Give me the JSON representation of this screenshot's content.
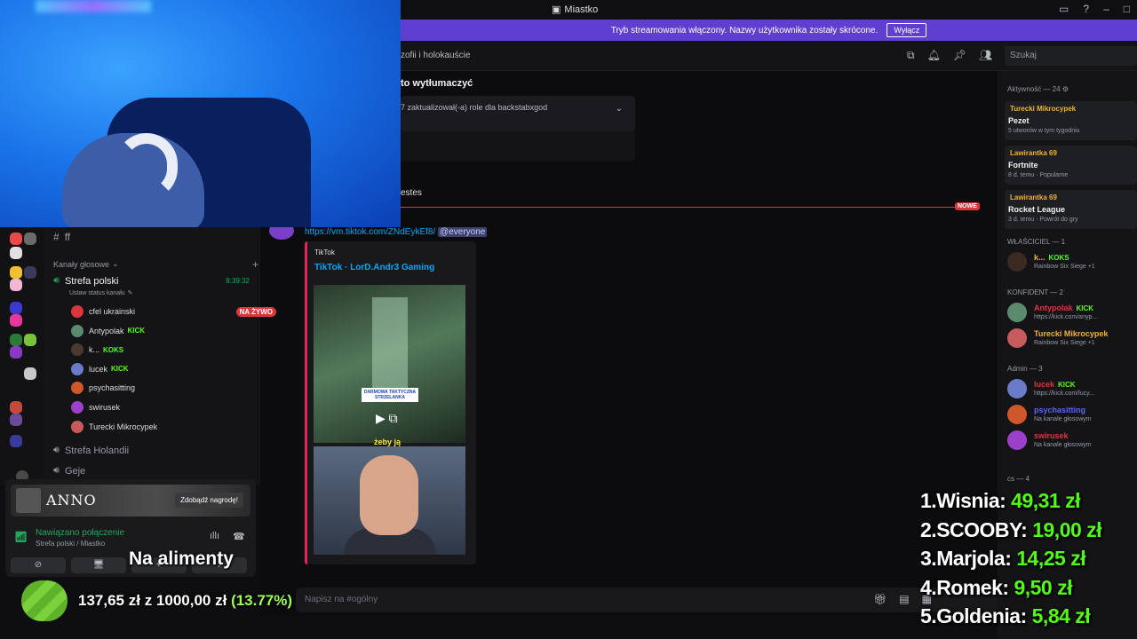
{
  "window": {
    "title": "Miastko",
    "stream_banner": "Tryb streamowania włączony. Nazwy użytkownika zostały skrócone.",
    "stream_banner_button": "Wyłącz"
  },
  "header": {
    "channel_partial": "zofii i holokauście",
    "search_placeholder": "Szukaj"
  },
  "chat": {
    "pinned_title": "to wytłumaczyć",
    "pinned_body": "7 zaktualizował(-a) role dla backstabxgod",
    "section_label": "estes",
    "new_badge": "NOWE",
    "link": "https://vm.tiktok.com/ZNdEykEf8/",
    "mention": "@everyone",
    "embed_provider": "TikTok",
    "embed_title": "TikTok · LorD.Andr3 Gaming",
    "thumb_caption": "DARMOWA TAKTYCZNA STRZELANKA",
    "thumb_subtitle": "żeby ją",
    "input_placeholder": "Napisz na #ogólny"
  },
  "sidebar": {
    "text_channel": "ff",
    "voice_category": "Kanały głosowe",
    "voice_channel": "Strefa polski",
    "voice_status": "Ustaw status kanału",
    "voice_timer": "8:39:32",
    "live_badge": "NA ŻYWO",
    "members": [
      {
        "name": "cfel ukrainski",
        "tag": "",
        "color": "#da373c"
      },
      {
        "name": "Antypolak",
        "tag": "KICK",
        "color": "#5b8a6f"
      },
      {
        "name": "k...",
        "tag": "KOKS",
        "color": "#4a3a2e"
      },
      {
        "name": "lucek",
        "tag": "KICK",
        "color": "#6a7cc9"
      },
      {
        "name": "psychasitting",
        "tag": "",
        "color": "#d0572a"
      },
      {
        "name": "swirusek",
        "tag": "",
        "color": "#9c40c9"
      },
      {
        "name": "Turecki Mikrocypek",
        "tag": "",
        "color": "#c75a5a"
      }
    ],
    "other_channels": [
      "Strefa Holandii",
      "Geje"
    ]
  },
  "user_panel": {
    "promo_logo": "ANNO",
    "promo_button": "Zdobądź nagrodę!",
    "connection": "Nawiązano połączenie",
    "connection_sub": "Strefa polski / Miastko"
  },
  "members_panel": {
    "activity_label": "Aktywność — 24",
    "activities": [
      {
        "who": "Turecki Mikrocypek",
        "game": "Pezet",
        "meta": "5 utworów w tym tygodniu"
      },
      {
        "who": "Lawirantka 69",
        "game": "Fortnite",
        "meta": "8 d. temu · Popularne"
      },
      {
        "who": "Lawirantka 69",
        "game": "Rocket League",
        "meta": "3 d. temu · Powrót do gry"
      }
    ],
    "roles": [
      {
        "label": "WŁAŚCICIEL — 1",
        "members": [
          {
            "name": "k...",
            "tag": "KOKS",
            "sub": "Rainbow Six Siege +1",
            "color": "#f0b232",
            "av": "#3a2a22"
          }
        ]
      },
      {
        "label": "KONFIDENT — 2",
        "members": [
          {
            "name": "Antypolak",
            "tag": "KICK",
            "sub": "https://kick.com/anyp...",
            "color": "#da373c",
            "av": "#5b8a6f"
          },
          {
            "name": "Turecki Mikrocypek",
            "tag": "",
            "sub": "Rainbow Six Siege +1",
            "color": "#f0b232",
            "av": "#c75a5a"
          }
        ]
      },
      {
        "label": "Admin — 3",
        "members": [
          {
            "name": "lucek",
            "tag": "KICK",
            "sub": "https://kick.com/lucy...",
            "color": "#da373c",
            "av": "#6a7cc9"
          },
          {
            "name": "psychasitting",
            "tag": "",
            "sub": "Na kanale głosowym",
            "color": "#5865f2",
            "av": "#d0572a"
          },
          {
            "name": "swirusek",
            "tag": "",
            "sub": "Na kanale głosowym",
            "color": "#da373c",
            "av": "#9c40c9"
          }
        ]
      }
    ],
    "cs_label": "cs — 4"
  },
  "overlay": {
    "goal_title": "Na alimenty",
    "goal_current": "137,65 zł",
    "goal_sep": "z",
    "goal_target": "1000,00 zł",
    "goal_percent": "(13.77%)",
    "goal_fraction": 0.1377,
    "leaderboard": [
      {
        "rank": "1.",
        "name": "Wisnia:",
        "amount": "49,31 zł"
      },
      {
        "rank": "2.",
        "name": "SCOOBY:",
        "amount": "19,00 zł"
      },
      {
        "rank": "3.",
        "name": "Marjola:",
        "amount": "14,25 zł"
      },
      {
        "rank": "4.",
        "name": "Romek:",
        "amount": "9,50 zł"
      },
      {
        "rank": "5.",
        "name": "Goldenia:",
        "amount": "5,84 zł"
      }
    ]
  }
}
